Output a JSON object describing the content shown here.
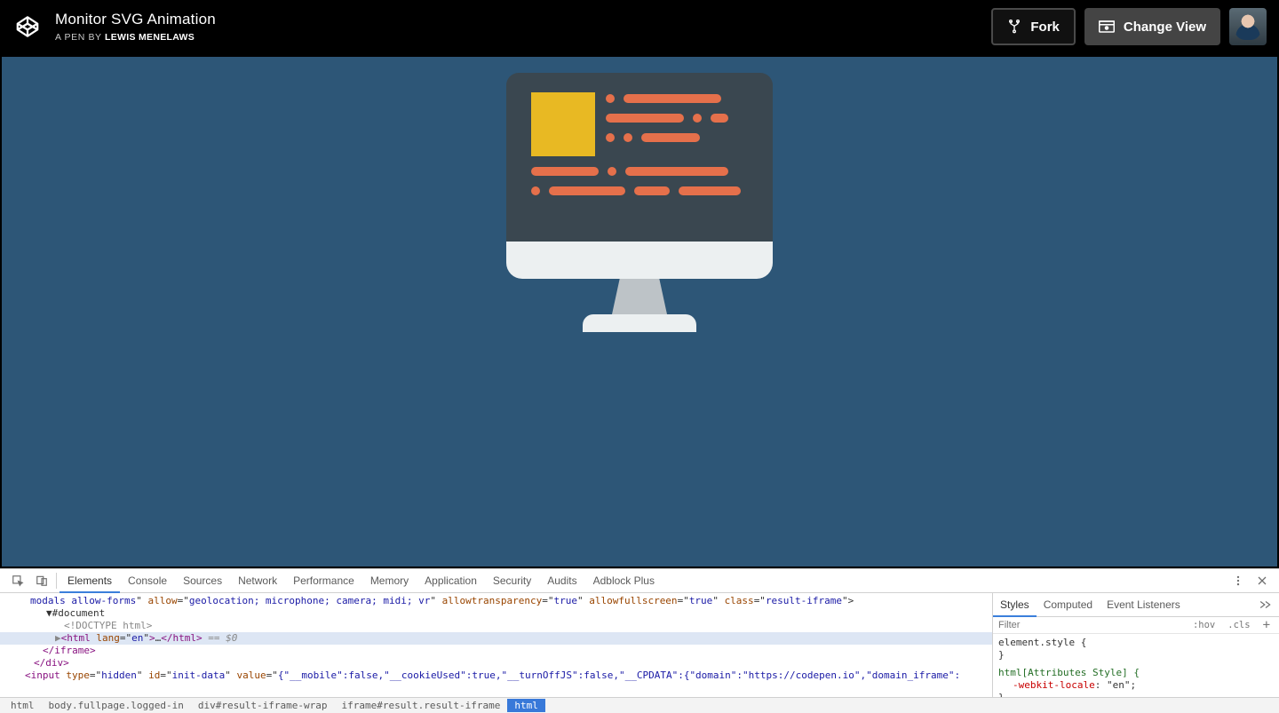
{
  "header": {
    "pen_title": "Monitor SVG Animation",
    "byline_prefix": "A PEN BY",
    "author": "Lewis Menelaws",
    "fork_label": "Fork",
    "change_view_label": "Change View"
  },
  "devtools": {
    "tabs": [
      "Elements",
      "Console",
      "Sources",
      "Network",
      "Performance",
      "Memory",
      "Application",
      "Security",
      "Audits",
      "Adblock Plus"
    ],
    "active_tab": "Elements",
    "styles_tabs": [
      "Styles",
      "Computed",
      "Event Listeners"
    ],
    "styles_active_tab": "Styles",
    "filter_placeholder": "Filter",
    "hov_label": ":hov",
    "cls_label": ".cls",
    "rule_element_style": "element.style {",
    "rule_element_style_close": "}",
    "rule_html_attrs": "html[Attributes Style] {",
    "prop_webkit_locale": "-webkit-locale",
    "val_webkit_locale": "\"en\"",
    "rule_close": "}",
    "elements_lines": {
      "l0_a": "modals allow-forms",
      "l0_b": "allow",
      "l0_c": "geolocation; microphone; camera; midi; vr",
      "l0_d": "allowtransparency",
      "l0_e": "true",
      "l0_f": "allowfullscreen",
      "l0_g": "class",
      "l0_h": "result-iframe",
      "l1": "▼#document",
      "l2": "<!DOCTYPE html>",
      "l3_a": "html",
      "l3_b": "lang",
      "l3_c": "en",
      "l3_d": "…",
      "l3_e": "/html",
      "l3_f": " == $0",
      "l4": "</iframe>",
      "l5": "</div>",
      "l6_a": "input",
      "l6_b": "type",
      "l6_c": "hidden",
      "l6_d": "id",
      "l6_e": "init-data",
      "l6_f": "value",
      "l6_g": "{\"__mobile\":false,\"__cookieUsed\":true,\"__turnOffJS\":false,\"__CPDATA\":{\"domain\":\"https://codepen.io\",\"domain_iframe\":"
    },
    "breadcrumb": [
      "html",
      "body.fullpage.logged-in",
      "div#result-iframe-wrap",
      "iframe#result.result-iframe",
      "html"
    ]
  }
}
